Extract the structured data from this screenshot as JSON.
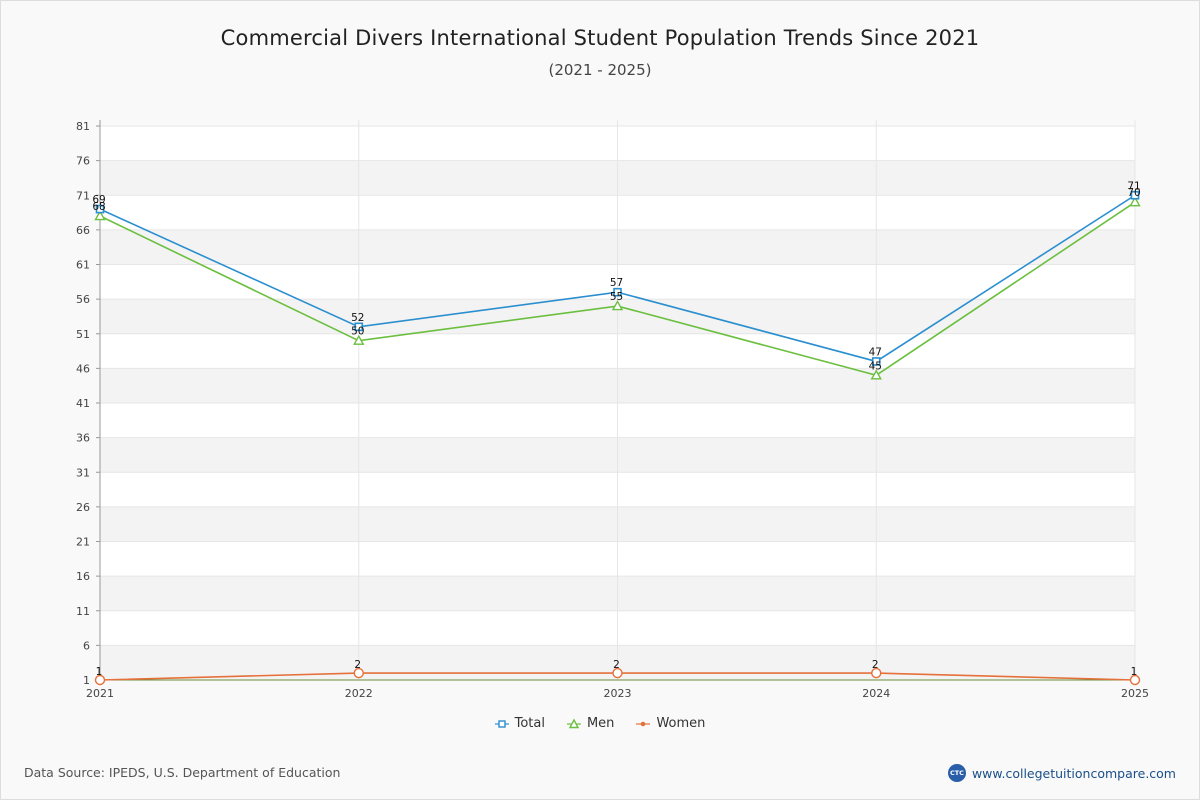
{
  "page": {
    "title": "Commercial Divers International Student Population Trends Since 2021",
    "subtitle": "(2021 - 2025)",
    "source": "Data Source: IPEDS, U.S. Department of Education",
    "brand": "www.collegetuitioncompare.com",
    "brand_logo_text": "CTC"
  },
  "chart_data": {
    "type": "line",
    "title": "Commercial Divers International Student Population Trends Since 2021",
    "subtitle": "(2021 - 2025)",
    "x": [
      "2021",
      "2022",
      "2023",
      "2024",
      "2025"
    ],
    "ylim": [
      1,
      81
    ],
    "yticks": [
      1,
      6,
      11,
      16,
      21,
      26,
      31,
      36,
      41,
      46,
      51,
      56,
      61,
      66,
      71,
      76,
      81
    ],
    "grid": true,
    "legend": "bottom-center",
    "series": [
      {
        "name": "Total",
        "values": [
          69,
          52,
          57,
          47,
          71
        ],
        "color": "#2b8fcf",
        "marker": "square"
      },
      {
        "name": "Men",
        "values": [
          68,
          50,
          55,
          45,
          70
        ],
        "color": "#6bbf3f",
        "marker": "triangle"
      },
      {
        "name": "Women",
        "values": [
          1,
          2,
          2,
          2,
          1
        ],
        "color": "#e5703a",
        "marker": "circle"
      }
    ]
  }
}
